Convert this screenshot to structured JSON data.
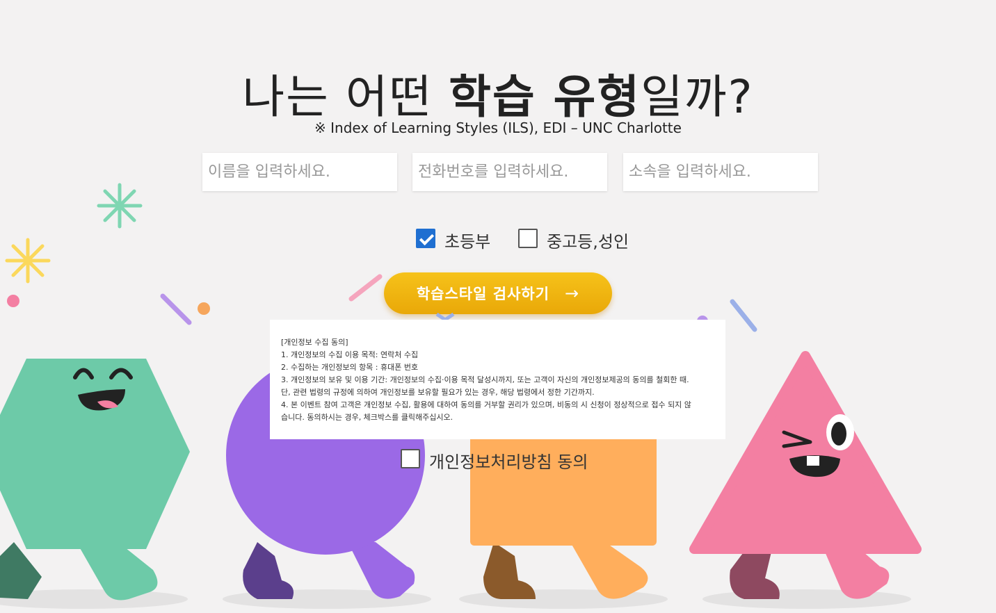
{
  "title": {
    "prefix": "나는 어떤 ",
    "bold": "학습 유형",
    "suffix": "일까?"
  },
  "subtitle": "※ Index of Learning Styles (ILS), EDI – UNC Charlotte",
  "form": {
    "name_placeholder": "이름을 입력하세요.",
    "phone_placeholder": "전화번호를 입력하세요.",
    "affiliation_placeholder": "소속을 입력하세요."
  },
  "grade_options": [
    {
      "label": "초등부",
      "checked": true
    },
    {
      "label": "중고등,성인",
      "checked": false
    }
  ],
  "cta": {
    "label": "학습스타일 검사하기",
    "arrow": "→"
  },
  "consent": {
    "lines": [
      "[개인정보 수집 동의]",
      "1. 개인정보의 수집 이용 목적: 연락처 수집",
      "2. 수집하는 개인정보의 항목 : 휴대폰 번호",
      "3. 개인정보의 보유 및 이용 기간: 개인정보의 수집·이용 목적 달성시까지, 또는 고객이 자신의 개인정보제공의 동의를 철회한 때.",
      "단, 관련 법령의 규정에 의하여 개인정보를 보유할 필요가 있는 경우, 해당 법령에서 정한 기간까지.",
      "4. 본 이벤트 참여 고객은 개인정보 수집, 활용에 대하여 동의를 거부할 권리가 있으며, 비동의 시 신청이 정상적으로 접수 되지 않",
      "습니다. 동의하시는 경우, 체크박스를 클릭해주십시오."
    ],
    "agree_label": "개인정보처리방침 동의",
    "agree_checked": false
  },
  "colors": {
    "background": "#f3f2f2",
    "cta": "#f2b411",
    "hexagon": "#6dcaa8",
    "circle": "#9b69e6",
    "rectangle": "#ffae5c",
    "triangle": "#f37fa2",
    "checkbox_checked": "#1f6fd1"
  },
  "decorations": [
    "green-asterisk-icon",
    "yellow-asterisk-icon",
    "hexagon-character",
    "circle-character",
    "rectangle-character",
    "triangle-character"
  ]
}
